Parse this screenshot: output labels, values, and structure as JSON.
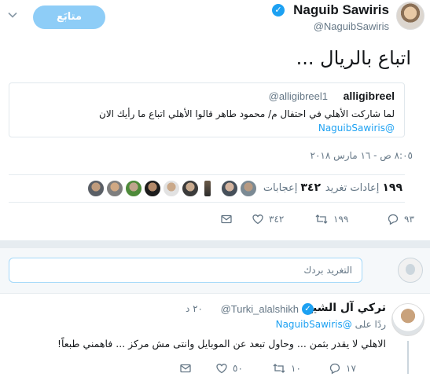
{
  "tweet": {
    "author_name": "Naguib Sawiris",
    "author_handle": "@NaguibSawiris",
    "follow_label": "متابَع",
    "text": "اتباع بالريال ...",
    "quoted": {
      "name": "alligibreel",
      "handle": "@alligibreel1",
      "body": "لما شاركت الأهلي في احتفال م/ محمود  طاهر قالوا الأهلي  اتباع ما رأيك الان",
      "mention": "@NaguibSawiris"
    },
    "timestamp": "٨:٠٥ ص - ١٦ مارس ٢٠١٨",
    "stats": {
      "retweets_count": "١٩٩",
      "retweets_label": "إعادات تغريد",
      "likes_count": "٣٤٢",
      "likes_label": "إعجابات"
    },
    "actions": {
      "replies": "٩٣",
      "retweets": "١٩٩",
      "likes": "٣٤٢"
    }
  },
  "reply_composer": {
    "placeholder": "التغريد بردك"
  },
  "reply": {
    "name": "تركي آل الشيخ",
    "handle": "@Turki_alalshikh",
    "time": "٢٠ د",
    "reply_to_label": "ردًا على",
    "reply_to_mention": "@NaguibSawiris",
    "body": "الاهلي لا يقدر بثمن ... وحاول تبعد عن الموبايل وانتى مش مركز ... فاهمني طبعاً!",
    "actions": {
      "replies": "١٧",
      "retweets": "١٠",
      "likes": "٥٠"
    }
  },
  "colors": {
    "brand_blue": "#1da1f2",
    "muted": "#657786",
    "follow_button": "#8ecdf7"
  }
}
